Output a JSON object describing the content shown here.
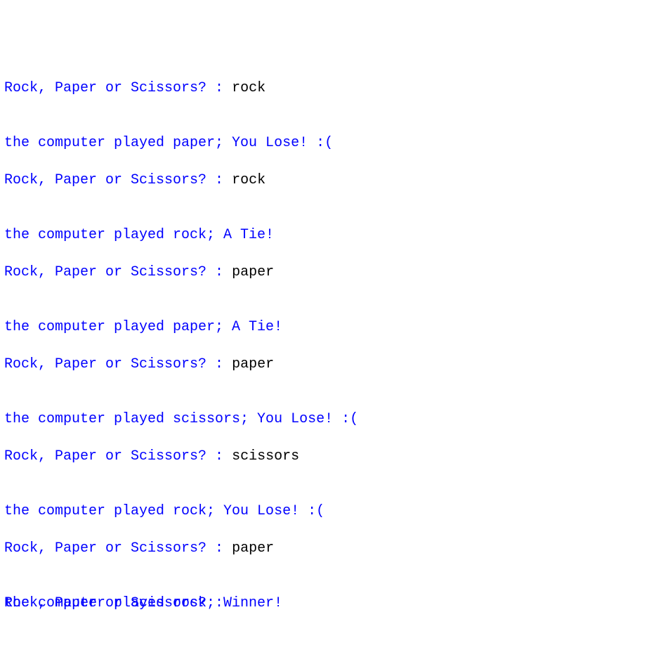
{
  "console": {
    "prompt_text": "Rock, Paper or Scissors? : ",
    "rounds": [
      {
        "input": "rock",
        "result": "the computer played paper; You Lose! :("
      },
      {
        "input": "rock",
        "result": "the computer played rock; A Tie!"
      },
      {
        "input": "paper",
        "result": "the computer played paper; A Tie!"
      },
      {
        "input": "paper",
        "result": "the computer played scissors; You Lose! :("
      },
      {
        "input": "scissors",
        "result": "the computer played rock; You Lose! :("
      },
      {
        "input": "paper",
        "result": "the computer played rock; Winner!"
      }
    ],
    "final_prompt": "Rock, Paper or Scissors? :",
    "colors": {
      "output": "#0000ff",
      "user_input": "#000000",
      "background": "#ffffff"
    }
  }
}
